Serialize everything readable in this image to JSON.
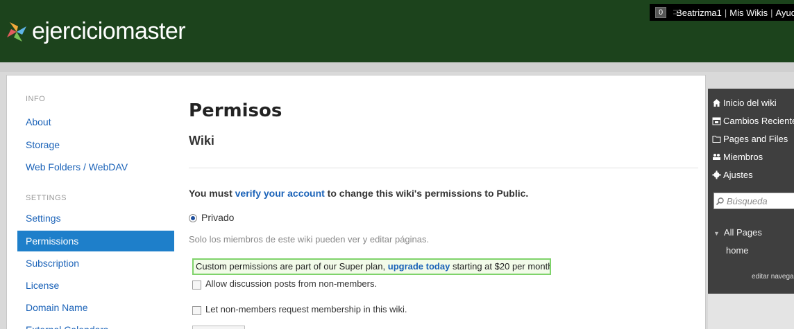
{
  "header": {
    "logo_text": "ejerciciomaster",
    "notification_count": "0",
    "username": "Beatrizma1",
    "links": [
      "Mis Wikis",
      "Ayuda"
    ],
    "separator": "|"
  },
  "sidebar": {
    "sections": [
      {
        "label": "INFO"
      },
      {
        "label": "SETTINGS"
      }
    ],
    "items": [
      {
        "label": "About"
      },
      {
        "label": "Storage"
      },
      {
        "label": "Web Folders / WebDAV"
      },
      {
        "label": "Settings"
      },
      {
        "label": "Permissions",
        "active": true
      },
      {
        "label": "Subscription"
      },
      {
        "label": "License"
      },
      {
        "label": "Domain Name"
      },
      {
        "label": "External Calendars"
      }
    ]
  },
  "main": {
    "title": "Permisos",
    "section_title": "Wiki",
    "verify_prefix": "You must ",
    "verify_link": "verify your account",
    "verify_suffix": " to change this wiki's permissions to Public.",
    "radio_label": "Privado",
    "radio_description": "Solo los miembros de este wiki pueden ver y editar páginas.",
    "promo_prefix": "Custom permissions are part of our Super plan, ",
    "promo_link": "upgrade today",
    "promo_suffix": " starting at $20 per month!",
    "checkboxes": [
      {
        "label": "Allow discussion posts from non-members."
      },
      {
        "label": "Let non-members request membership in this wiki."
      }
    ]
  },
  "right_nav": {
    "items": [
      {
        "label": "Inicio del wiki",
        "icon": "home-icon"
      },
      {
        "label": "Cambios Recientes",
        "icon": "calendar-icon"
      },
      {
        "label": "Pages and Files",
        "icon": "folder-icon"
      },
      {
        "label": "Miembros",
        "icon": "members-icon"
      },
      {
        "label": "Ajustes",
        "icon": "gear-icon"
      }
    ],
    "search_placeholder": "Búsqueda",
    "all_pages_label": "All Pages",
    "home_page_label": "home",
    "edit_nav_label": "editar navegación"
  },
  "colors": {
    "header_bg": "#1c431c",
    "active_nav_bg": "#1e7fca",
    "link": "#1a62b8",
    "promo_border": "#7fd36b",
    "right_nav_bg": "#3f3f3f"
  }
}
